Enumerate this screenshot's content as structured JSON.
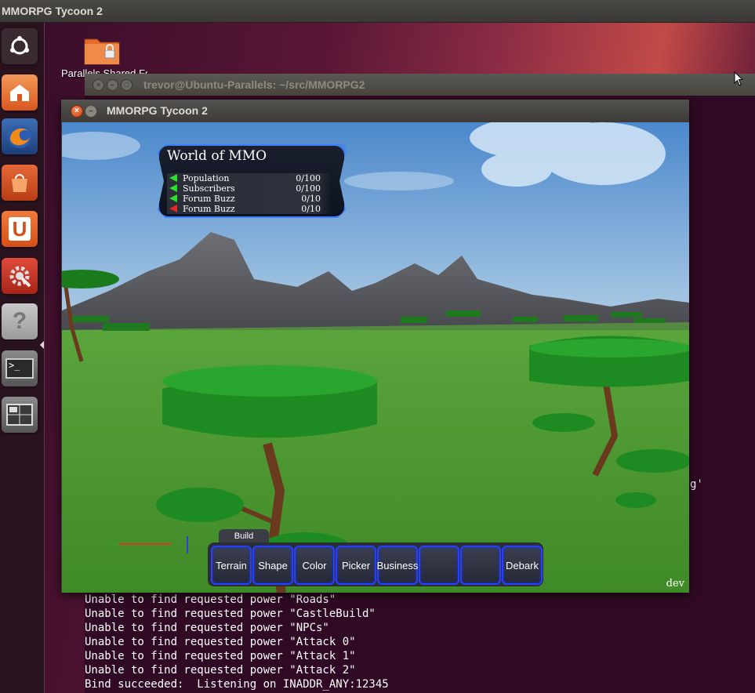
{
  "top_panel": {
    "title": "MMORPG Tycoon 2"
  },
  "desktop": {
    "shared_folder_label": "Parallels Shared Folders"
  },
  "launcher": {
    "items": [
      {
        "name": "ubuntu-dash"
      },
      {
        "name": "home-folder"
      },
      {
        "name": "firefox"
      },
      {
        "name": "software-center"
      },
      {
        "name": "ubuntu-one"
      },
      {
        "name": "system-settings"
      },
      {
        "name": "help"
      },
      {
        "name": "terminal"
      },
      {
        "name": "workspace-switcher"
      }
    ]
  },
  "terminal": {
    "title": "trevor@Ubuntu-Parallels: ~/src/MMORPG2",
    "side_fragment": "g'",
    "lines": [
      "Unable to find requested power \"Roads\"",
      "Unable to find requested power \"CastleBuild\"",
      "Unable to find requested power \"NPCs\"",
      "Unable to find requested power \"Attack 0\"",
      "Unable to find requested power \"Attack 1\"",
      "Unable to find requested power \"Attack 2\"",
      "Bind succeeded:  Listening on INADDR_ANY:12345"
    ]
  },
  "game": {
    "title": "MMORPG Tycoon 2",
    "world": {
      "title": "World of MMO",
      "stats": [
        {
          "name": "Population",
          "value": "0/100",
          "arrow": "#2fdc2f"
        },
        {
          "name": "Subscribers",
          "value": "0/100",
          "arrow": "#2fdc2f"
        },
        {
          "name": "Forum Buzz",
          "value": "0/10",
          "arrow": "#2fdc2f"
        },
        {
          "name": "Forum Buzz",
          "value": "0/10",
          "arrow": "#e02a2a"
        }
      ]
    },
    "build_tab": "Build",
    "toolbar": [
      "Terrain",
      "Shape",
      "Color",
      "Picker",
      "Business",
      "",
      "",
      "Debark"
    ],
    "dev_label": "dev"
  },
  "colors": {
    "accent_blue": "#2642ff",
    "panel_glow": "#3f7dff"
  }
}
